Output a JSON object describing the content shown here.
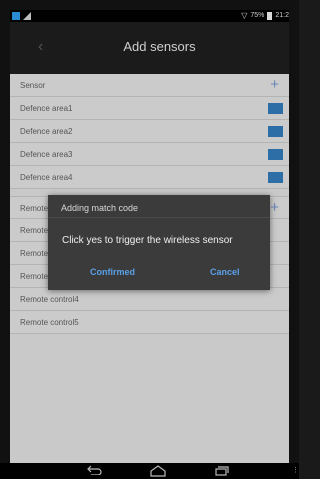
{
  "status_bar": {
    "battery_text": "75%",
    "time_text": "21:2",
    "icons": [
      "app-notification-icon",
      "signal-icon",
      "wifi-icon",
      "battery-icon"
    ]
  },
  "header": {
    "title": "Add sensors",
    "back_icon": "chevron-left-icon"
  },
  "sensors": {
    "header_label": "Sensor",
    "items": [
      {
        "label": "Defence area1",
        "enabled": true
      },
      {
        "label": "Defence area2",
        "enabled": true
      },
      {
        "label": "Defence area3",
        "enabled": true
      },
      {
        "label": "Defence area4",
        "enabled": true
      }
    ]
  },
  "remotes": {
    "header_label": "Remote control",
    "items": [
      {
        "label": "Remote control1"
      },
      {
        "label": "Remote control2"
      },
      {
        "label": "Remote control3"
      },
      {
        "label": "Remote control4"
      },
      {
        "label": "Remote control5"
      }
    ]
  },
  "dialog": {
    "title": "Adding match code",
    "message": "Click yes to trigger the wireless sensor",
    "confirm_label": "Confirmed",
    "cancel_label": "Cancel"
  },
  "colors": {
    "accent": "#2e6ea6",
    "dialog_button": "#5aa0e6",
    "plus_icon": "#6a86b8"
  }
}
